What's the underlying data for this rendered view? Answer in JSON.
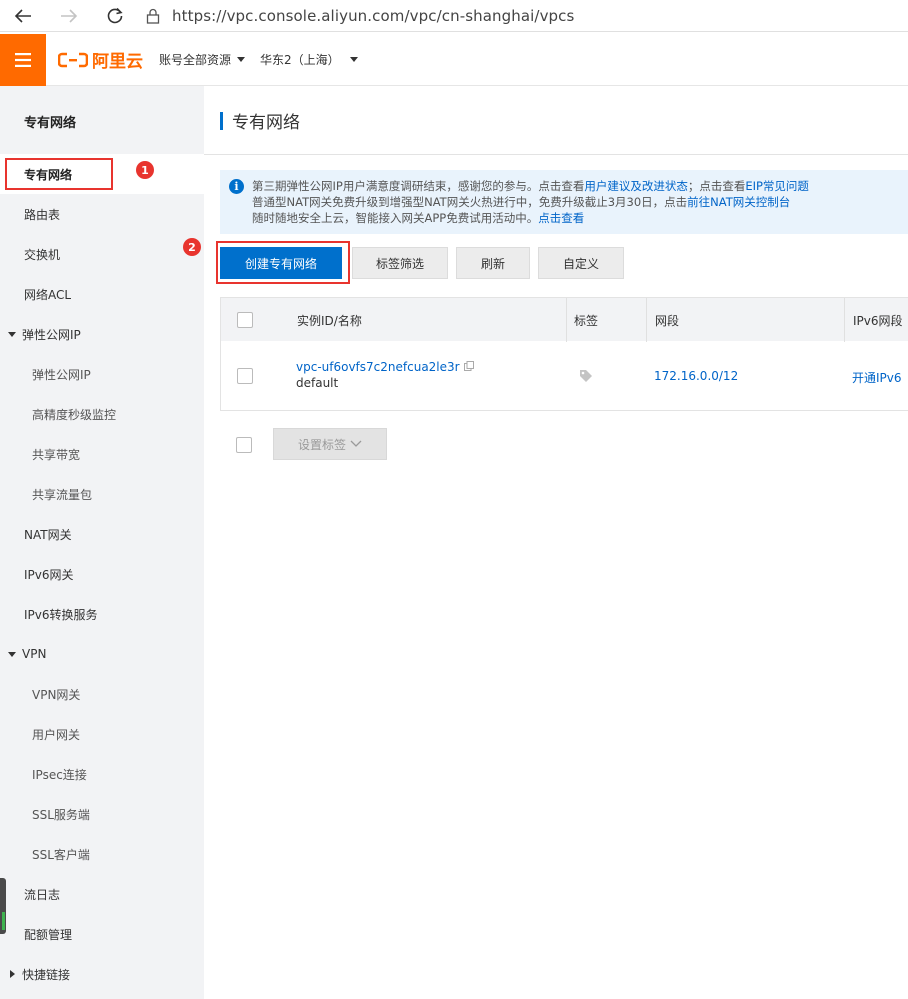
{
  "browser": {
    "url": "https://vpc.console.aliyun.com/vpc/cn-shanghai/vpcs"
  },
  "header": {
    "brand": "阿里云",
    "account_scope": "账号全部资源",
    "region": "华东2（上海）"
  },
  "sidebar": {
    "title": "专有网络",
    "items": [
      {
        "label": "专有网络"
      },
      {
        "label": "路由表"
      },
      {
        "label": "交换机"
      },
      {
        "label": "网络ACL"
      },
      {
        "label": "弹性公网IP"
      },
      {
        "label": "弹性公网IP"
      },
      {
        "label": "高精度秒级监控"
      },
      {
        "label": "共享带宽"
      },
      {
        "label": "共享流量包"
      },
      {
        "label": "NAT网关"
      },
      {
        "label": "IPv6网关"
      },
      {
        "label": "IPv6转换服务"
      },
      {
        "label": "VPN"
      },
      {
        "label": "VPN网关"
      },
      {
        "label": "用户网关"
      },
      {
        "label": "IPsec连接"
      },
      {
        "label": "SSL服务端"
      },
      {
        "label": "SSL客户端"
      },
      {
        "label": "流日志"
      },
      {
        "label": "配额管理"
      },
      {
        "label": "快捷链接"
      }
    ]
  },
  "main": {
    "page_title": "专有网络",
    "notice": {
      "line1_text": "第三期弹性公网IP用户满意度调研结束，感谢您的参与。点击查看",
      "line1_link1": "用户建议及改进状态",
      "line1_mid": "；点击查看",
      "line1_link2": "EIP常见问题",
      "line2_text": "普通型NAT网关免费升级到增强型NAT网关火热进行中，免费升级截止3月30日，点击",
      "line2_link": "前往NAT网关控制台",
      "line3_text": "随时随地安全上云，智能接入网关APP免费试用活动中。",
      "line3_link": "点击查看"
    },
    "badges": {
      "first": "1",
      "second": "2"
    },
    "toolbar": {
      "create": "创建专有网络",
      "tag_filter": "标签筛选",
      "refresh": "刷新",
      "customize": "自定义"
    },
    "table": {
      "columns": [
        "实例ID/名称",
        "标签",
        "网段",
        "IPv6网段"
      ],
      "rows": [
        {
          "id": "vpc-uf6ovfs7c2nefcua2le3r",
          "name": "default",
          "cidr": "172.16.0.0/12",
          "ipv6": "开通IPv6"
        }
      ]
    },
    "bulk": {
      "set_tags": "设置标签"
    }
  },
  "colors": {
    "brand_orange": "#ff6a00",
    "primary_blue": "#0070cc",
    "annotation_red": "#e8342e"
  }
}
